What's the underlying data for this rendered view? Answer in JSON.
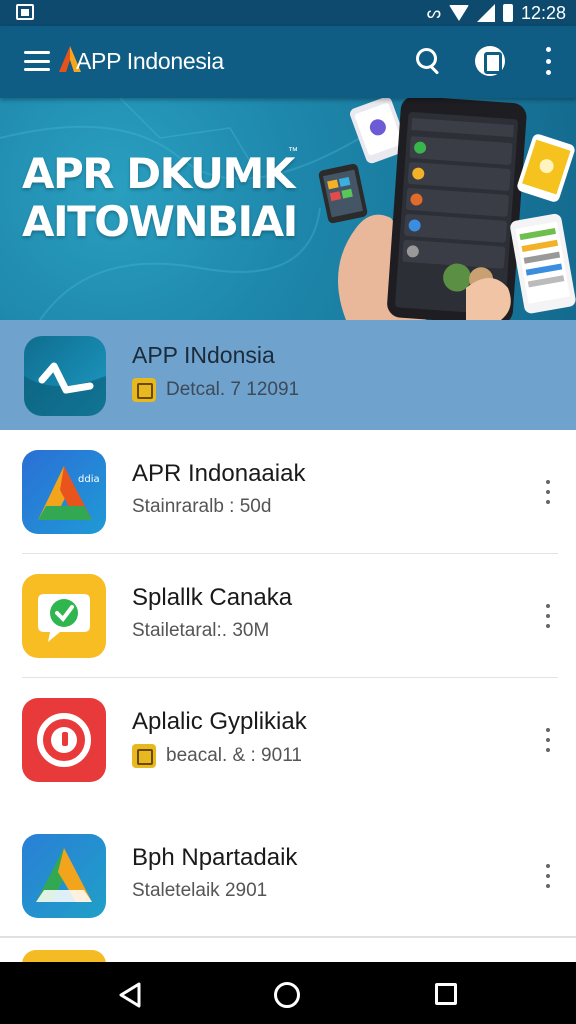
{
  "status_bar": {
    "time": "12:28",
    "vibrate_glyph": "ᔕ"
  },
  "app_bar": {
    "title": "APP Indonesia",
    "icons": [
      "menu-icon",
      "search-icon",
      "account-icon",
      "more-vert-icon"
    ]
  },
  "banner": {
    "line1": "APR DKUMK",
    "line2": "AITOWNBIAI",
    "trademark": "™"
  },
  "featured": {
    "name": "APP INdonsia",
    "meta": "Detcal. 7 12091"
  },
  "apps": [
    {
      "name": "APR Indonaaiak",
      "meta": "Stainraralb : 50d",
      "badge": false,
      "icon_label": "ddia"
    },
    {
      "name": "Splallk Canaka",
      "meta": "Stailetaral:. 30M",
      "badge": false
    },
    {
      "name": "Aplalic Gyplikiak",
      "meta": "beacal. & : 9011",
      "badge": true
    },
    {
      "name": "Bph Npartadaik",
      "meta": "Staletelaik 2901",
      "badge": false
    }
  ],
  "colors": {
    "status_bar": "#0d4a6e",
    "app_bar": "#0f5c85",
    "featured_bg": "#6fa2cc",
    "accent_yellow": "#f4bb25"
  }
}
